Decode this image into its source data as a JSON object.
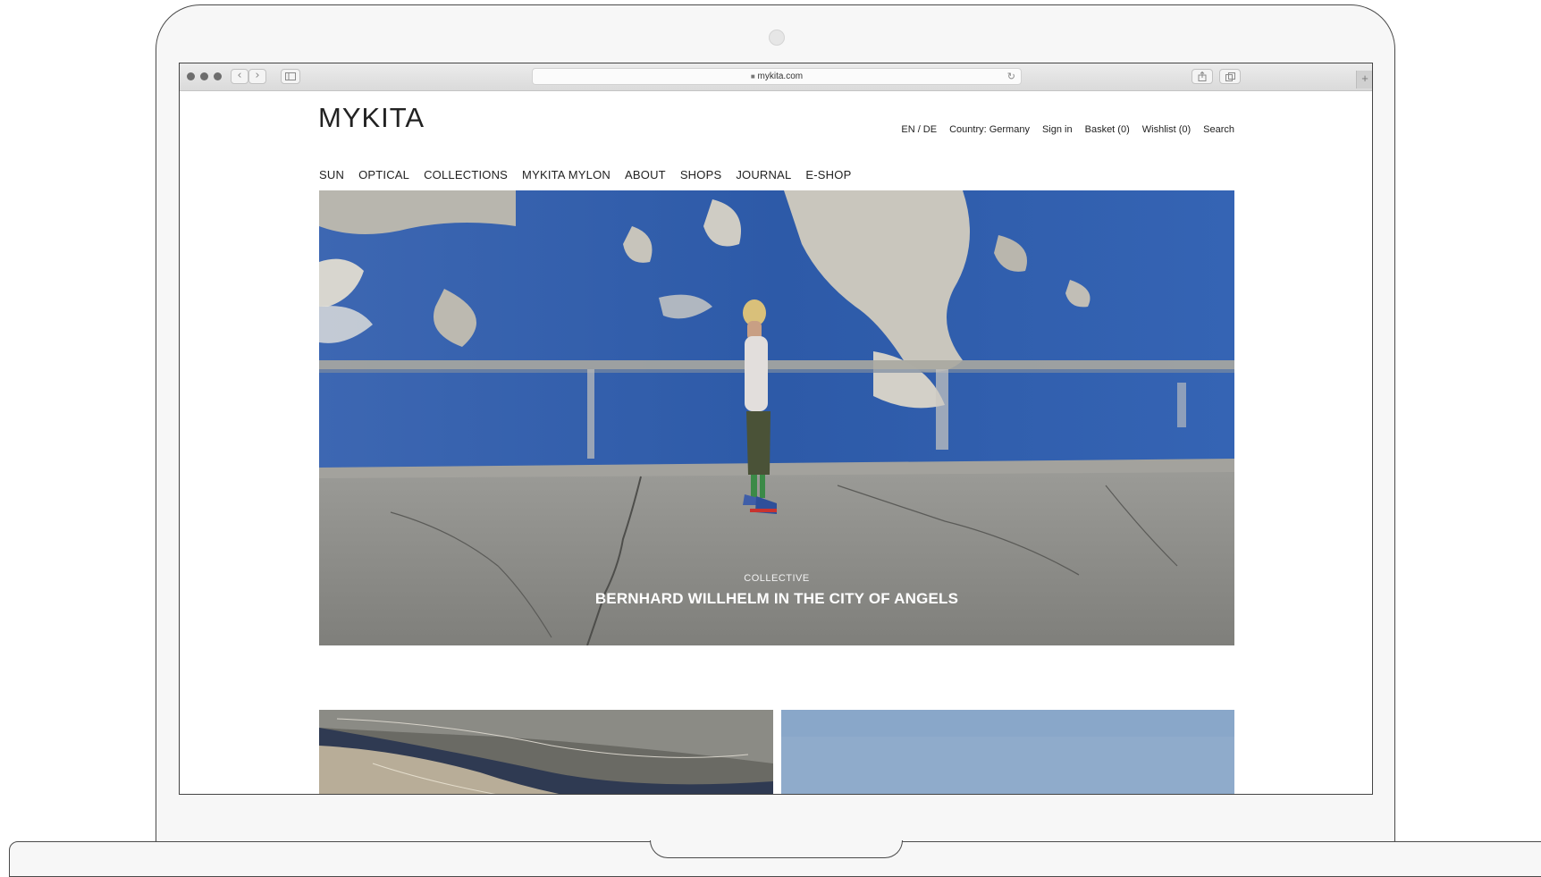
{
  "browser": {
    "url": "mykita.com",
    "lock_icon": "lock-icon",
    "back_icon": "chevron-left-icon",
    "forward_icon": "chevron-right-icon",
    "sidebar_icon": "sidebar-icon",
    "share_icon": "share-icon",
    "tabs_icon": "tabs-icon",
    "reload_icon": "reload-icon",
    "new_tab_icon": "plus-icon"
  },
  "site": {
    "logo": "MYKITA",
    "util_links": [
      "EN / DE",
      "Country: Germany",
      "Sign in",
      "Basket (0)",
      "Wishlist (0)",
      "Search"
    ],
    "nav": [
      "SUN",
      "OPTICAL",
      "COLLECTIONS",
      "MYKITA MYLON",
      "ABOUT",
      "SHOPS",
      "JOURNAL",
      "E-SHOP"
    ]
  },
  "hero": {
    "kicker": "COLLECTIVE",
    "title": "BERNHARD WILLHELM IN THE CITY OF ANGELS"
  },
  "colors": {
    "wall_blue": "#2f5fae",
    "sky_blue": "#8eabcb",
    "concrete": "#8d8d89",
    "text": "#222222"
  }
}
